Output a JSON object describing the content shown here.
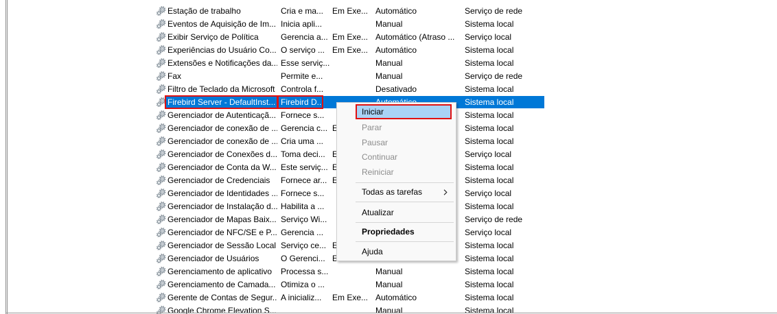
{
  "icons": {
    "service": "gear-icon",
    "submenu": "chevron-right-icon"
  },
  "colors": {
    "selection": "#0078d7",
    "selection_text": "#ffffff",
    "menu_highlight": "#a9d3f5",
    "annotation": "#e01010",
    "disabled_text": "#8c8c8c"
  },
  "services": {
    "rows": [
      {
        "name": "Estação de trabalho",
        "description": "Cria e ma...",
        "status": "Em Exe...",
        "startup": "Automático",
        "logon": "Serviço de rede"
      },
      {
        "name": "Eventos de Aquisição de Im...",
        "description": "Inicia apli...",
        "status": "",
        "startup": "Manual",
        "logon": "Sistema local"
      },
      {
        "name": "Exibir Serviço de Política",
        "description": "Gerencia a...",
        "status": "Em Exe...",
        "startup": "Automático (Atraso ...",
        "logon": "Serviço local"
      },
      {
        "name": "Experiências do Usuário Co...",
        "description": "O serviço ...",
        "status": "Em Exe...",
        "startup": "Automático",
        "logon": "Sistema local"
      },
      {
        "name": "Extensões e Notificações da...",
        "description": "Esse serviç...",
        "status": "",
        "startup": "Manual",
        "logon": "Sistema local"
      },
      {
        "name": "Fax",
        "description": "Permite e...",
        "status": "",
        "startup": "Manual",
        "logon": "Serviço de rede"
      },
      {
        "name": "Filtro de Teclado da Microsoft",
        "description": "Controla f...",
        "status": "",
        "startup": "Desativado",
        "logon": "Sistema local"
      },
      {
        "name": "Firebird Server - DefaultInst...",
        "description": "Firebird D...",
        "status": "",
        "startup": "Automático",
        "logon": "Sistema local",
        "selected": true
      },
      {
        "name": "Gerenciador de Autenticaçã...",
        "description": "Fornece s...",
        "status": "",
        "startup": "",
        "logon": "Sistema local"
      },
      {
        "name": "Gerenciador de conexão de ...",
        "description": "Gerencia c...",
        "status": "E",
        "startup": "",
        "logon": "Sistema local"
      },
      {
        "name": "Gerenciador de conexão de ...",
        "description": "Cria uma ...",
        "status": "",
        "startup": "",
        "logon": "Sistema local"
      },
      {
        "name": "Gerenciador de Conexões d...",
        "description": "Toma deci...",
        "status": "E",
        "startup": "",
        "logon": "Serviço local"
      },
      {
        "name": "Gerenciador de Conta da W...",
        "description": "Este serviç...",
        "status": "E",
        "startup": "",
        "logon": "Sistema local"
      },
      {
        "name": "Gerenciador de Credenciais",
        "description": "Fornece ar...",
        "status": "E",
        "startup": "",
        "logon": "Sistema local"
      },
      {
        "name": "Gerenciador de Identidades ...",
        "description": "Fornece s...",
        "status": "",
        "startup": "",
        "logon": "Serviço local"
      },
      {
        "name": "Gerenciador de Instalação d...",
        "description": "Habilita a ...",
        "status": "",
        "startup": "",
        "logon": "Sistema local"
      },
      {
        "name": "Gerenciador de Mapas Baix...",
        "description": "Serviço Wi...",
        "status": "",
        "startup": "",
        "logon": "Serviço de rede"
      },
      {
        "name": "Gerenciador de NFC/SE e P...",
        "description": "Gerencia ...",
        "status": "",
        "startup": "",
        "logon": "Serviço local"
      },
      {
        "name": "Gerenciador de Sessão Local",
        "description": "Serviço ce...",
        "status": "E",
        "startup": "",
        "logon": "Sistema local"
      },
      {
        "name": "Gerenciador de Usuários",
        "description": "O Gerenci...",
        "status": "E",
        "startup": "",
        "logon": "Sistema local"
      },
      {
        "name": "Gerenciamento de aplicativo",
        "description": "Processa s...",
        "status": "",
        "startup": "Manual",
        "logon": "Sistema local"
      },
      {
        "name": "Gerenciamento de Camada...",
        "description": "Otimiza o ...",
        "status": "",
        "startup": "Manual",
        "logon": "Sistema local"
      },
      {
        "name": "Gerente de Contas de Segur...",
        "description": "A inicializ...",
        "status": "Em Exe...",
        "startup": "Automático",
        "logon": "Sistema local"
      },
      {
        "name": "Google Chrome Elevation S...",
        "description": "",
        "status": "",
        "startup": "Manual",
        "logon": "Sistema local"
      }
    ]
  },
  "context_menu": {
    "items": [
      {
        "label": "Iniciar",
        "enabled": true,
        "highlighted": true
      },
      {
        "label": "Parar",
        "enabled": false
      },
      {
        "label": "Pausar",
        "enabled": false
      },
      {
        "label": "Continuar",
        "enabled": false
      },
      {
        "label": "Reiniciar",
        "enabled": false
      },
      {
        "label": "Todas as tarefas",
        "enabled": true,
        "submenu": true
      },
      {
        "label": "Atualizar",
        "enabled": true
      },
      {
        "label": "Propriedades",
        "enabled": true,
        "default": true
      },
      {
        "label": "Ajuda",
        "enabled": true
      }
    ]
  }
}
